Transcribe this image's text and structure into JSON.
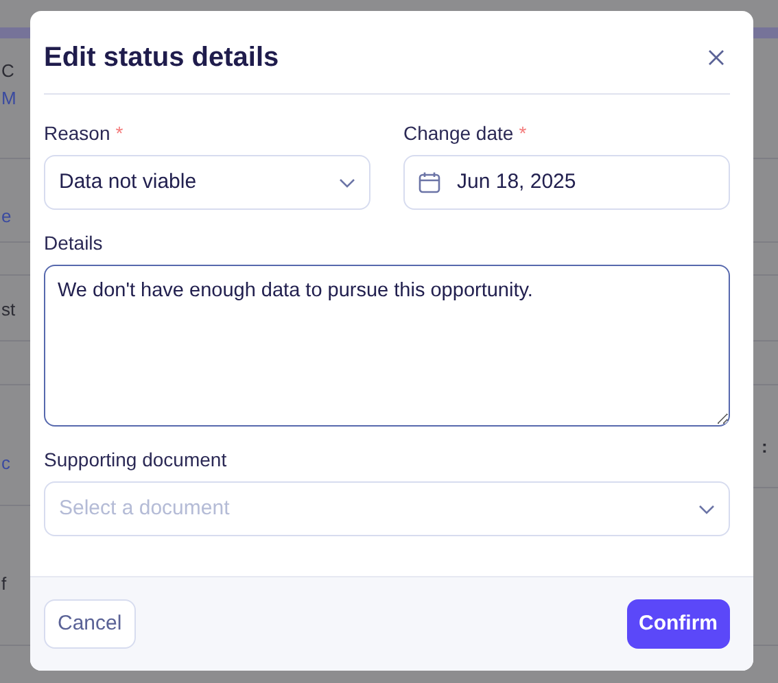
{
  "background": {
    "left_fragments": [
      {
        "text": "C",
        "kind": "text"
      },
      {
        "text": "M",
        "kind": "link"
      },
      {
        "text": "e",
        "kind": "link"
      },
      {
        "text": "st",
        "kind": "text"
      },
      {
        "text": "c",
        "kind": "link"
      },
      {
        "text": "f",
        "kind": "text"
      }
    ],
    "right_fragments": [
      {
        "text": ":"
      }
    ]
  },
  "dialog": {
    "title": "Edit status details",
    "reason": {
      "label": "Reason",
      "required_mark": "*",
      "value": "Data not viable"
    },
    "change_date": {
      "label": "Change date",
      "required_mark": "*",
      "value": "Jun 18, 2025"
    },
    "details": {
      "label": "Details",
      "value": "We don't have enough data to pursue this opportunity.",
      "focused": true
    },
    "supporting_document": {
      "label": "Supporting document",
      "placeholder": "Select a document"
    },
    "buttons": [
      {
        "label": "Cancel",
        "kind": "secondary"
      },
      {
        "label": "Confirm",
        "kind": "primary"
      }
    ]
  }
}
